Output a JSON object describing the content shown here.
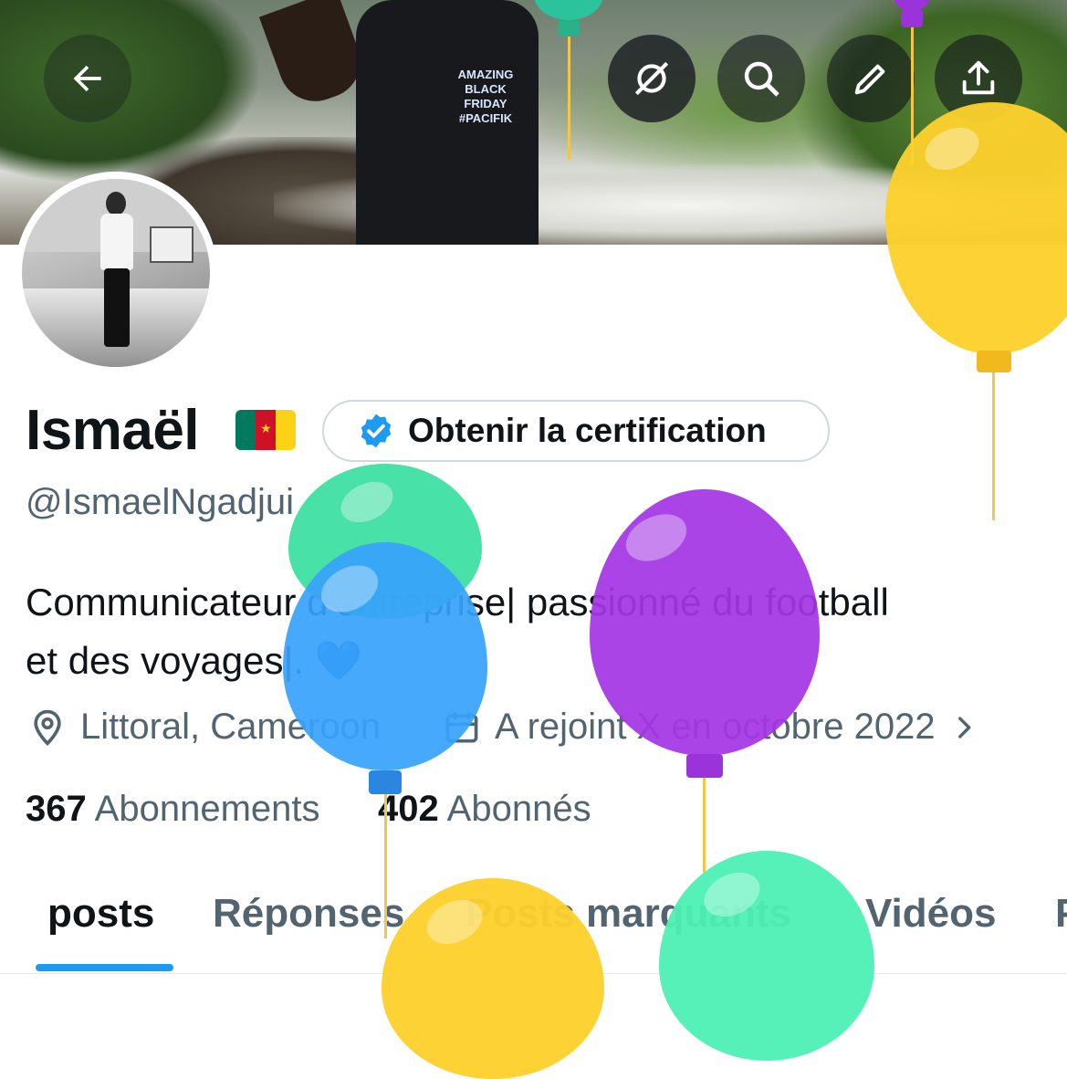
{
  "header": {
    "back_icon": "arrow-left-icon",
    "actions": [
      "incognito-icon",
      "search-icon",
      "edit-icon",
      "share-icon"
    ]
  },
  "banner": {
    "tshirt_text": "AMAZING BLACK FRIDAY #PACIFIK"
  },
  "profile": {
    "name": "Ismaël",
    "flag_emoji": "Cameroon",
    "handle": "@IsmaelNgadjui",
    "certification_label": "Obtenir la certification",
    "bio_line1": "Communicateur d'entreprise| passionné du football",
    "bio_line2": "et des voyages|. 💙",
    "location": "Littoral, Cameroon",
    "joined": "A rejoint X en octobre 2022",
    "following_count": "367",
    "following_label": "Abonnements",
    "followers_count": "402",
    "followers_label": "Abonnés"
  },
  "tabs": [
    {
      "label": "posts",
      "active": true
    },
    {
      "label": "Réponses",
      "active": false
    },
    {
      "label": "Posts marquants",
      "active": false
    },
    {
      "label": "Vidéos",
      "active": false
    },
    {
      "label": "P",
      "active": false
    }
  ],
  "colors": {
    "accent": "#1d9bf0",
    "text_primary": "#0f1419",
    "text_secondary": "#536471",
    "verified_badge": "#1d9bf0"
  }
}
